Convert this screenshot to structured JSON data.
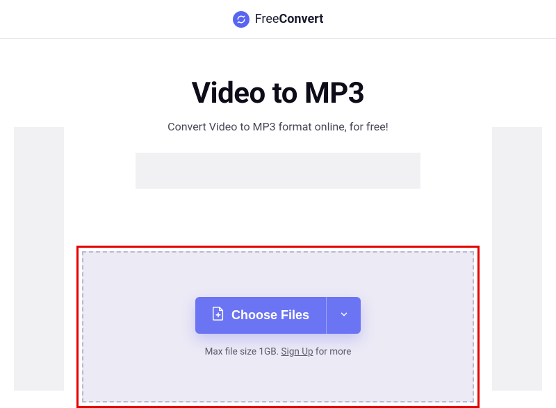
{
  "header": {
    "logo_free": "Free",
    "logo_convert": "Convert"
  },
  "hero": {
    "title": "Video to MP3",
    "subtitle": "Convert Video to MP3 format online, for free!"
  },
  "dropzone": {
    "choose_label": "Choose Files",
    "note_prefix": "Max file size 1GB. ",
    "signup_label": "Sign Up",
    "note_suffix": " for more"
  }
}
